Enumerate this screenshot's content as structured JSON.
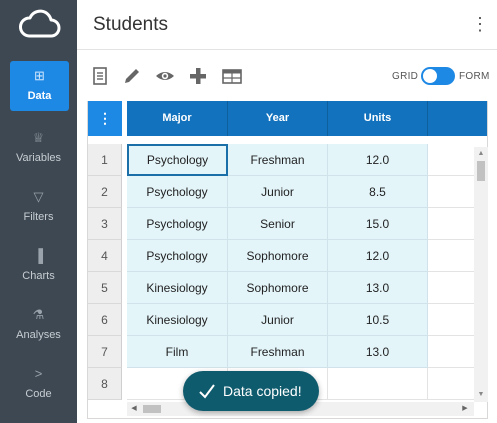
{
  "sidebar": {
    "logo": "cloud-icon",
    "items": [
      {
        "label": "Data",
        "icon": "grid-icon",
        "glyph": "⊞",
        "active": true
      },
      {
        "label": "Variables",
        "icon": "variables-icon",
        "glyph": "♕",
        "active": false
      },
      {
        "label": "Filters",
        "icon": "filter-icon",
        "glyph": "▽",
        "active": false
      },
      {
        "label": "Charts",
        "icon": "bar-chart-icon",
        "glyph": "▐",
        "active": false
      },
      {
        "label": "Analyses",
        "icon": "flask-icon",
        "glyph": "⚗",
        "active": false
      },
      {
        "label": "Code",
        "icon": "chevron-right-icon",
        "glyph": ">",
        "active": false
      }
    ]
  },
  "header": {
    "title": "Students",
    "menu_icon": "more-vertical-icon"
  },
  "toolbar": {
    "tools": [
      "document-icon",
      "pencil-icon",
      "eye-icon",
      "plus-icon",
      "table-icon"
    ],
    "toggle_left": "GRID",
    "toggle_right": "FORM",
    "toggle_color": "#1e88e5"
  },
  "grid": {
    "corner_glyph": "⋮",
    "columns": [
      "Major",
      "Year",
      "Units",
      ""
    ],
    "rows": [
      {
        "num": "1",
        "cells": [
          "Psychology",
          "Freshman",
          "12.0",
          ""
        ]
      },
      {
        "num": "2",
        "cells": [
          "Psychology",
          "Junior",
          "8.5",
          ""
        ]
      },
      {
        "num": "3",
        "cells": [
          "Psychology",
          "Senior",
          "15.0",
          ""
        ]
      },
      {
        "num": "4",
        "cells": [
          "Psychology",
          "Sophomore",
          "12.0",
          ""
        ]
      },
      {
        "num": "5",
        "cells": [
          "Kinesiology",
          "Sophomore",
          "13.0",
          ""
        ]
      },
      {
        "num": "6",
        "cells": [
          "Kinesiology",
          "Junior",
          "10.5",
          ""
        ]
      },
      {
        "num": "7",
        "cells": [
          "Film",
          "Freshman",
          "13.0",
          ""
        ]
      },
      {
        "num": "8",
        "cells": [
          "",
          "",
          "",
          ""
        ]
      }
    ],
    "selected_cell": "row 1, Major",
    "header_color": "#1272bd",
    "cell_color": "#e4f5fa"
  },
  "toast": {
    "message": "Data copied!",
    "icon": "check-icon",
    "color": "#0f5b6e"
  }
}
